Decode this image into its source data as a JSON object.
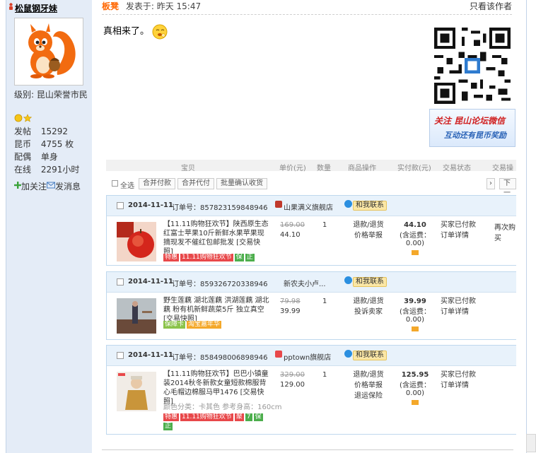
{
  "user": {
    "name": "松鼠钢牙妹",
    "level_label": "级别: 昆山荣誉市民",
    "stats": [
      {
        "key": "发帖",
        "value": "15292"
      },
      {
        "key": "昆币",
        "value": "4755 枚"
      },
      {
        "key": "配偶",
        "value": "单身"
      },
      {
        "key": "在线",
        "value": "2291小时"
      }
    ],
    "add_follow": "加关注",
    "send_message": "发消息"
  },
  "post": {
    "floor": "板凳",
    "posted_at": "发表于: 昨天 15:47",
    "only_author": "只看该作者",
    "text": "真相来了。",
    "banner_line1": "关注 昆山论坛微信",
    "banner_line2": "互动还有昆币奖励"
  },
  "shot": {
    "columns": [
      "宝贝",
      "单价(元)",
      "数量",
      "商品操作",
      "实付款(元)",
      "交易状态",
      "交易操"
    ],
    "toolbar": {
      "select_all": "全选",
      "merge_pay": "合并付款",
      "merge_proxy": "合并代付",
      "batch_confirm": "批量确认收货",
      "next": "下一"
    },
    "orders": [
      {
        "date": "2014-11-11",
        "order_no": "订单号：857823159848946",
        "shop": "山果满义旗舰店",
        "contact": "和我联系",
        "title": "【11.11购物狂欢节】陕西原生态红富士苹果10斤新鲜水果苹果现摘现发不催红包邮批发 [交易快照]",
        "tags": [
          "特惠",
          "11.11购物狂欢节",
          "保",
          "正"
        ],
        "old_price": "169.00",
        "price": "44.10",
        "qty": "1",
        "ops": [
          "退款/退货",
          "价格举报"
        ],
        "total": "44.10",
        "shipping": "(含运费：0.00)",
        "status": [
          "买家已付款",
          "订单详情"
        ],
        "repeat": "再次购买"
      },
      {
        "date": "2014-11-11",
        "order_no": "订单号：859326720338946",
        "shop": "新农夫小卢...",
        "contact": "和我联系",
        "title": "野生莲藕 湖北莲藕 洪湖莲藕 湖北藕 粉有机新鲜蔬菜5斤 独立真空 [交易快照]",
        "tags": [
          "保障卡",
          "淘宝嘉年华"
        ],
        "old_price": "79.98",
        "price": "39.99",
        "qty": "1",
        "ops": [
          "退款/退货",
          "投诉卖家"
        ],
        "total": "39.99",
        "shipping": "(含运费：0.00)",
        "status": [
          "买家已付款",
          "订单详情"
        ],
        "repeat": ""
      },
      {
        "date": "2014-11-11",
        "order_no": "订单号：858498006898946",
        "shop": "pptown旗舰店",
        "contact": "和我联系",
        "title": "【11.11购物狂欢节】巴巴小镇童装2014秋冬新款女童短款棉服背心毛帽边棉服马甲1476 [交易快照]",
        "sku": "颜色分类：卡其色  参考身高：160cm",
        "tags": [
          "特惠",
          "11.11购物狂欢节",
          "聚",
          "7",
          "保",
          "正"
        ],
        "old_price": "329.00",
        "price": "129.00",
        "qty": "1",
        "ops": [
          "退款/退货",
          "价格举报",
          "退运保险"
        ],
        "total": "125.95",
        "shipping": "(含运费：0.00)",
        "status": [
          "买家已付款",
          "订单详情"
        ],
        "repeat": ""
      }
    ]
  }
}
